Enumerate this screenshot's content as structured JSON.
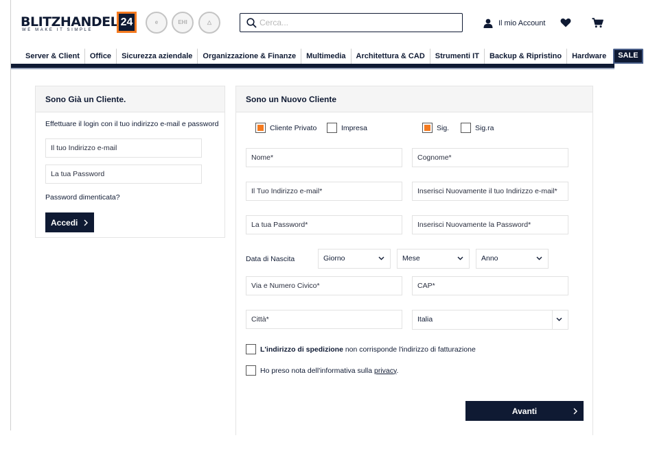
{
  "header": {
    "logo_word": "BLITZHANDEL",
    "logo_badge": "24",
    "logo_tagline": "WE MAKE IT SIMPLE",
    "trust_badges": [
      "e",
      "EHI",
      "△"
    ],
    "search_placeholder": "Cerca...",
    "account_label": "Il mio Account",
    "icons": {
      "search": "search-icon",
      "account": "user-icon",
      "wishlist": "heart-icon",
      "cart": "cart-icon"
    }
  },
  "nav": {
    "items": [
      "Server & Client",
      "Office",
      "Sicurezza aziendale",
      "Organizzazione & Finanze",
      "Multimedia",
      "Architettura & CAD",
      "Strumenti IT",
      "Backup & Ripristino",
      "Hardware"
    ],
    "sale": "SALE"
  },
  "login": {
    "title": "Sono Già un Cliente.",
    "description": "Effettuare il login con il tuo indirizzo e-mail e password",
    "email_placeholder": "Il tuo Indirizzo e-mail",
    "password_placeholder": "La tua Password",
    "forgot": "Password dimenticata?",
    "submit": "Accedi"
  },
  "register": {
    "title": "Sono un Nuovo Cliente",
    "customer_types": [
      {
        "label": "Cliente Privato",
        "checked": true
      },
      {
        "label": "Impresa",
        "checked": false
      }
    ],
    "salutations": [
      {
        "label": "Sig.",
        "checked": true
      },
      {
        "label": "Sig.ra",
        "checked": false
      }
    ],
    "fields": {
      "first_name": "Nome*",
      "last_name": "Cognome*",
      "email": "Il Tuo Indirizzo e-mail*",
      "email_confirm": "Inserisci Nuovamente il tuo Indirizzo e-mail*",
      "password": "La tua Password*",
      "password_confirm": "Inserisci Nuovamente la Password*",
      "street": "Via e Numero Civico*",
      "zip": "CAP*",
      "city": "Città*"
    },
    "dob_label": "Data di Nascita",
    "dob": {
      "day": "Giorno",
      "month": "Mese",
      "year": "Anno"
    },
    "country": "Italia",
    "shipping_bold": "L'indirizzo di spedizione",
    "shipping_rest": " non corrisponde l'indirizzo di fatturazione",
    "privacy_prefix": "Ho preso nota dell'informativa sulla ",
    "privacy_link": "privacy",
    "privacy_suffix": ".",
    "submit": "Avanti"
  },
  "colors": {
    "brand_navy": "#0f1a33",
    "brand_orange": "#f47a20"
  }
}
